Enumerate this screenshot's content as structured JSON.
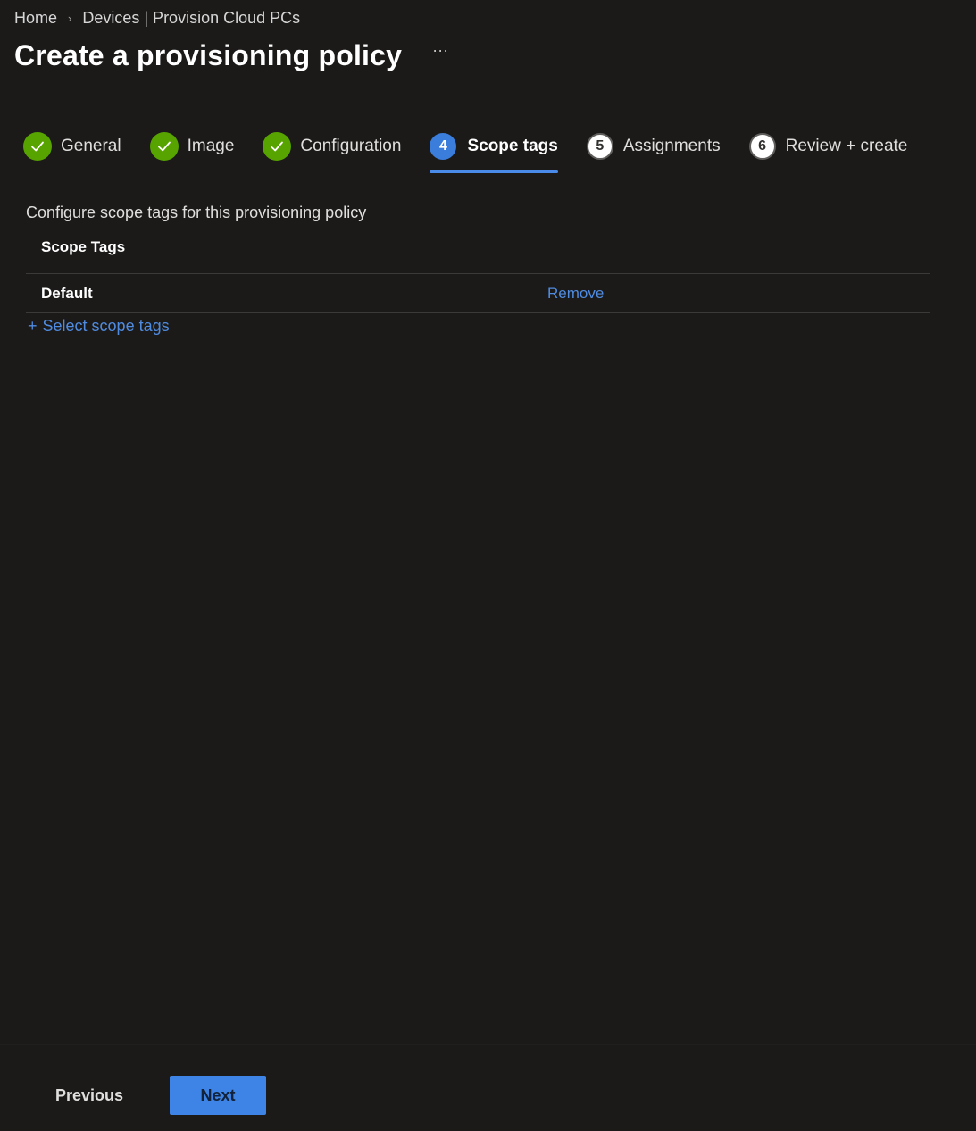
{
  "breadcrumb": {
    "items": [
      "Home",
      "Devices | Provision Cloud PCs"
    ],
    "separator": "›"
  },
  "header": {
    "title": "Create a provisioning policy",
    "more_label": "···"
  },
  "steps": [
    {
      "label": "General",
      "status": "done",
      "number": "1"
    },
    {
      "label": "Image",
      "status": "done",
      "number": "2"
    },
    {
      "label": "Configuration",
      "status": "done",
      "number": "3"
    },
    {
      "label": "Scope tags",
      "status": "current",
      "number": "4"
    },
    {
      "label": "Assignments",
      "status": "todo",
      "number": "5"
    },
    {
      "label": "Review + create",
      "status": "todo",
      "number": "6"
    }
  ],
  "main": {
    "description": "Configure scope tags for this provisioning policy",
    "table": {
      "header": "Scope Tags",
      "rows": [
        {
          "name": "Default",
          "action": "Remove"
        }
      ]
    },
    "add_link": {
      "plus": "+",
      "label": "Select scope tags"
    }
  },
  "footer": {
    "previous_label": "Previous",
    "next_label": "Next"
  },
  "colors": {
    "background": "#1b1a19",
    "accent": "#3e83e6",
    "link": "#4f8be0",
    "success": "#57a300"
  }
}
